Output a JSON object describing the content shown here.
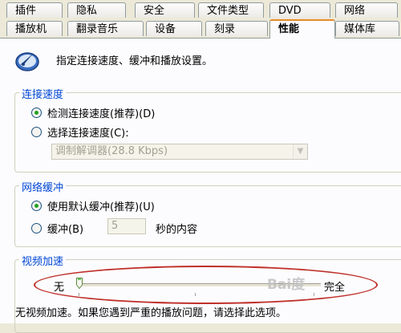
{
  "tabs_row1": [
    "插件",
    "隐私",
    "安全",
    "文件类型",
    "DVD",
    "网络"
  ],
  "tabs_row2": [
    "播放机",
    "翻录音乐",
    "设备",
    "刻录",
    "性能",
    "媒体库"
  ],
  "active_tab_index": 4,
  "header_text": "指定连接速度、缓冲和播放设置。",
  "connection": {
    "title": "连接速度",
    "detect_label": "检测连接速度(推荐)(D)",
    "choose_label": "选择连接速度(C):",
    "select_value": "调制解调器(28.8 Kbps)",
    "selected": "detect"
  },
  "buffer": {
    "title": "网络缓冲",
    "default_label": "使用默认缓冲(推荐)(U)",
    "custom_label": "缓冲(B)",
    "seconds_value": "5",
    "seconds_suffix": "秒的内容",
    "selected": "default"
  },
  "video": {
    "title": "视频加速",
    "min_label": "无",
    "max_label": "完全",
    "slider_level": 0.0,
    "description": "无视频加速。如果您遇到严重的播放问题，请选择此选项。"
  },
  "watermark": "Bai度",
  "colors": {
    "accent_tab": "#e68b2c",
    "group_title": "#0046d5",
    "annotation": "#c0302a"
  }
}
